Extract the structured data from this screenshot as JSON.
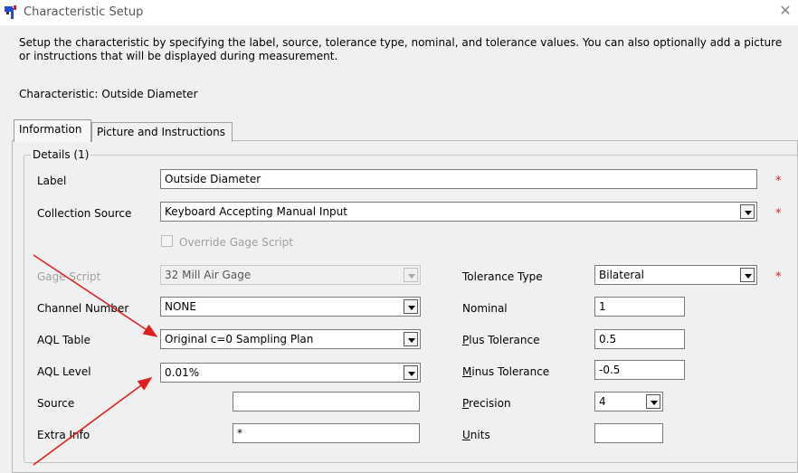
{
  "window": {
    "title": "Characteristic Setup"
  },
  "description": "Setup the characteristic by specifying the label, source, tolerance type, nominal, and tolerance values. You can also optionally add a picture or instructions that will be displayed during measurement.",
  "characteristic_line": "Characteristic: Outside Diameter",
  "tabs": [
    {
      "label": "Information",
      "active": true
    },
    {
      "label": "Picture and Instructions",
      "active": false
    }
  ],
  "group": {
    "label": "Details (1)"
  },
  "fields": {
    "label": {
      "label": "Label",
      "value": "Outside Diameter"
    },
    "collection_source": {
      "label": "Collection Source",
      "value": "Keyboard Accepting Manual Input"
    },
    "override_gage": {
      "label": "Override Gage Script"
    },
    "gage_script": {
      "label": "Gage Script",
      "value": "32 Mill Air Gage"
    },
    "channel_number": {
      "label": "Channel Number",
      "value": "NONE"
    },
    "aql_table": {
      "label": "AQL Table",
      "value": "Original c=0 Sampling Plan"
    },
    "aql_level": {
      "label": "AQL Level",
      "value": "0.01%"
    },
    "source": {
      "label": "Source",
      "value": ""
    },
    "extra_info": {
      "label": "Extra Info",
      "value": "*"
    },
    "tolerance_type": {
      "label": "Tolerance Type",
      "value": "Bilateral"
    },
    "nominal": {
      "label": "Nominal",
      "value": "1"
    },
    "plus_tolerance": {
      "label_accel": "P",
      "label_rest": "lus Tolerance",
      "value": "0.5"
    },
    "minus_tolerance": {
      "label_accel": "M",
      "label_rest": "inus Tolerance",
      "value": "-0.5"
    },
    "precision": {
      "label_accel": "P",
      "label_rest": "recision",
      "value": "4"
    },
    "units": {
      "label_accel": "U",
      "label_rest": "nits",
      "value": ""
    }
  },
  "required_marker": "*",
  "colors": {
    "required": "#e02020",
    "annotation_arrow": "#e02020",
    "disabled_text": "#a0a0a0"
  }
}
